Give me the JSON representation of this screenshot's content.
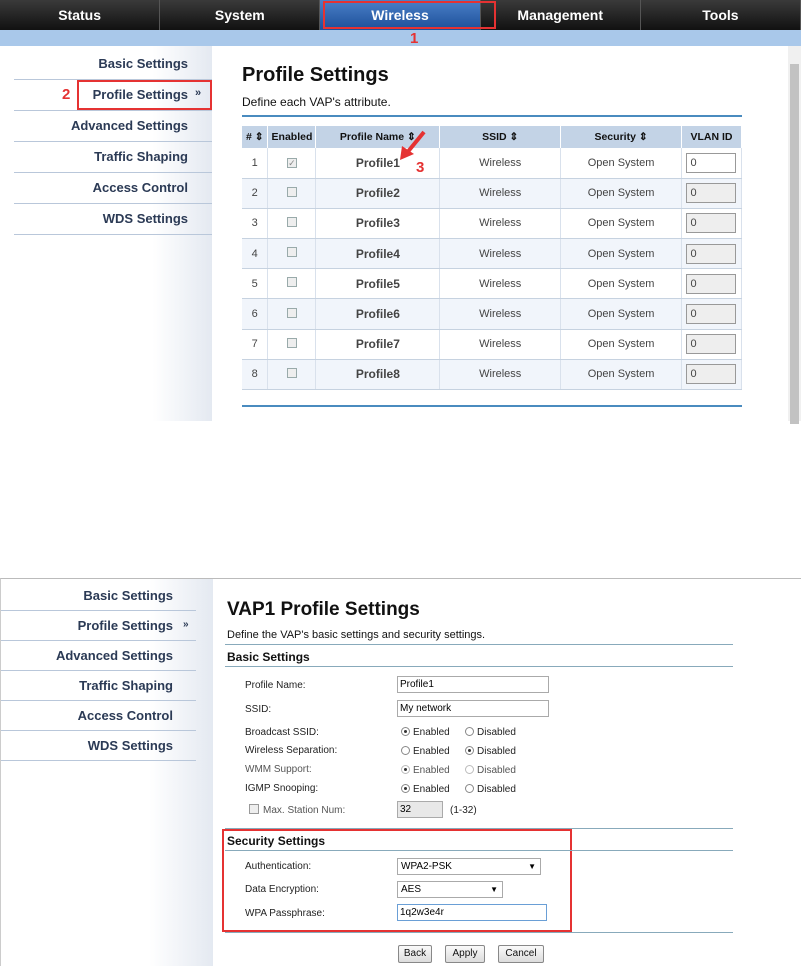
{
  "top": {
    "nav": [
      "Status",
      "System",
      "Wireless",
      "Management",
      "Tools"
    ],
    "callout1": "1",
    "callout2": "2",
    "callout3": "3",
    "sidebar": [
      "Basic Settings",
      "Profile Settings",
      "Advanced Settings",
      "Traffic Shaping",
      "Access Control",
      "WDS Settings"
    ],
    "active_marker": "»",
    "title": "Profile Settings",
    "description": "Define each VAP's attribute.",
    "table": {
      "headers": [
        "#",
        "Enabled",
        "Profile Name",
        "SSID",
        "Security",
        "VLAN ID"
      ],
      "sort_glyph": "⇕",
      "rows": [
        {
          "num": "1",
          "name": "Profile1",
          "ssid": "Wireless",
          "security": "Open System",
          "vlan": "0",
          "checked": true
        },
        {
          "num": "2",
          "name": "Profile2",
          "ssid": "Wireless",
          "security": "Open System",
          "vlan": "0",
          "checked": false
        },
        {
          "num": "3",
          "name": "Profile3",
          "ssid": "Wireless",
          "security": "Open System",
          "vlan": "0",
          "checked": false
        },
        {
          "num": "4",
          "name": "Profile4",
          "ssid": "Wireless",
          "security": "Open System",
          "vlan": "0",
          "checked": false
        },
        {
          "num": "5",
          "name": "Profile5",
          "ssid": "Wireless",
          "security": "Open System",
          "vlan": "0",
          "checked": false
        },
        {
          "num": "6",
          "name": "Profile6",
          "ssid": "Wireless",
          "security": "Open System",
          "vlan": "0",
          "checked": false
        },
        {
          "num": "7",
          "name": "Profile7",
          "ssid": "Wireless",
          "security": "Open System",
          "vlan": "0",
          "checked": false
        },
        {
          "num": "8",
          "name": "Profile8",
          "ssid": "Wireless",
          "security": "Open System",
          "vlan": "0",
          "checked": false
        }
      ]
    }
  },
  "bottom": {
    "sidebar": [
      "Basic Settings",
      "Profile Settings",
      "Advanced Settings",
      "Traffic Shaping",
      "Access Control",
      "WDS Settings"
    ],
    "active_marker": "»",
    "title": "VAP1 Profile Settings",
    "description": "Define the VAP's basic settings and security settings.",
    "basic_title": "Basic Settings",
    "profile_name_label": "Profile Name:",
    "profile_name_value": "Profile1",
    "ssid_label": "SSID:",
    "ssid_value": "My network",
    "broadcast_label": "Broadcast SSID:",
    "separation_label": "Wireless Separation:",
    "wmm_label": "WMM Support:",
    "igmp_label": "IGMP Snooping:",
    "enabled_label": "Enabled",
    "disabled_label": "Disabled",
    "max_station_label": "Max. Station Num:",
    "max_station_value": "32",
    "max_station_range": "(1-32)",
    "security_title": "Security Settings",
    "auth_label": "Authentication:",
    "auth_value": "WPA2-PSK",
    "encryption_label": "Data Encryption:",
    "encryption_value": "AES",
    "passphrase_label": "WPA Passphrase:",
    "passphrase_value": "1q2w3e4r",
    "dropdown_arrow": "▼",
    "back_label": "Back",
    "apply_label": "Apply",
    "cancel_label": "Cancel"
  },
  "colors": {
    "highlight": "#e53232",
    "nav_active": "#2f62ad",
    "link": "#2535b5"
  }
}
